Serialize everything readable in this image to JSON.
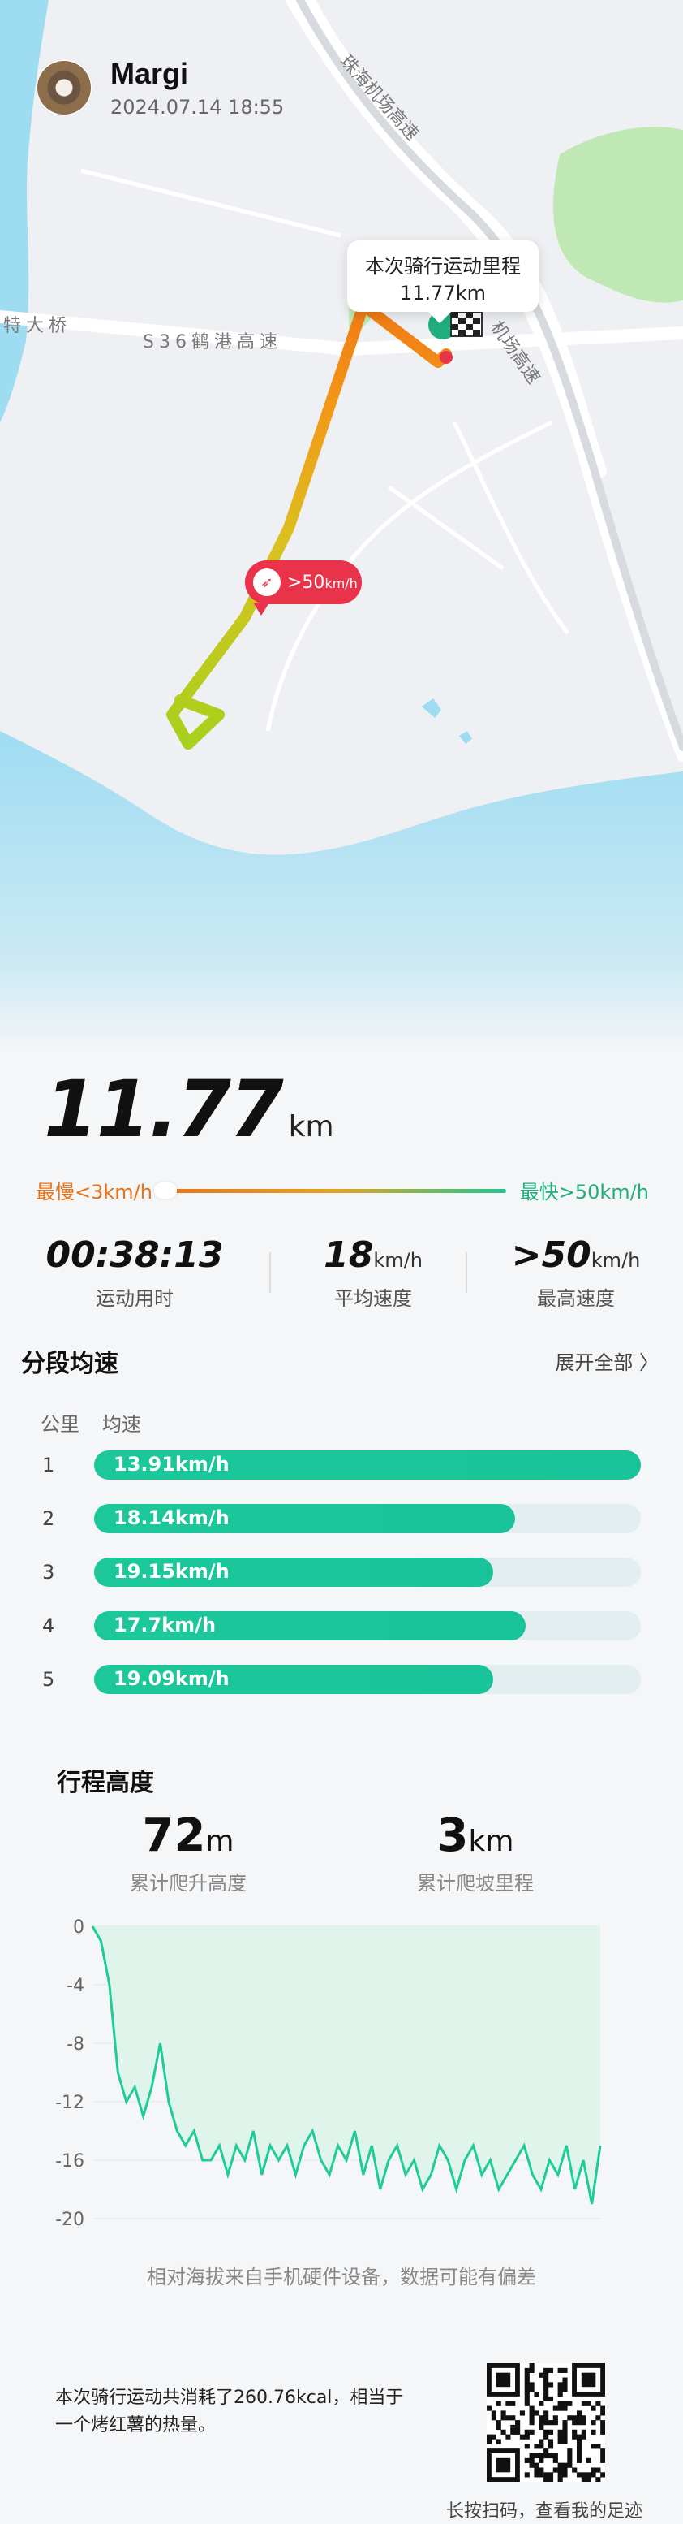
{
  "user": {
    "name": "Margi",
    "datetime": "2024.07.14 18:55"
  },
  "map": {
    "road_labels": [
      "珠海机场高速",
      "S36鹤港高速",
      "特大桥",
      "机场高速"
    ],
    "tooltip_line1": "本次骑行运动里程",
    "tooltip_line2": "11.77km",
    "speed_marker_prefix": ">50",
    "speed_marker_unit": "km/h",
    "colors": {
      "water": "#9edcf2",
      "land": "#eef0f3",
      "park": "#bfe8b4",
      "route_start": "#a7d11c",
      "route_end": "#f07a14"
    }
  },
  "summary": {
    "distance": "11.77",
    "distance_unit": "km",
    "slowest_label": "最慢<3km/h",
    "fastest_label": "最快>50km/h",
    "duration": "00:38:13",
    "duration_label": "运动用时",
    "avg_speed": "18",
    "avg_speed_unit": "km/h",
    "avg_speed_label": "平均速度",
    "max_speed": ">50",
    "max_speed_unit": "km/h",
    "max_speed_label": "最高速度"
  },
  "segments": {
    "title": "分段均速",
    "expand_label": "展开全部 〉",
    "col_km": "公里",
    "col_speed": "均速",
    "rows": [
      {
        "km": "1",
        "speed": "13.91km/h",
        "fill": 1.0
      },
      {
        "km": "2",
        "speed": "18.14km/h",
        "fill": 0.77
      },
      {
        "km": "3",
        "speed": "19.15km/h",
        "fill": 0.73
      },
      {
        "km": "4",
        "speed": "17.7km/h",
        "fill": 0.79
      },
      {
        "km": "5",
        "speed": "19.09km/h",
        "fill": 0.73
      }
    ]
  },
  "altitude": {
    "title": "行程高度",
    "climb": "72",
    "climb_unit": "m",
    "climb_label": "累计爬升高度",
    "climb_dist": "3",
    "climb_dist_unit": "km",
    "climb_dist_label": "累计爬坡里程",
    "note": "相对海拔来自手机硬件设备，数据可能有偏差"
  },
  "chart_data": {
    "type": "area",
    "title": "",
    "xlabel": "",
    "ylabel": "",
    "ylim": [
      -20,
      0
    ],
    "yticks": [
      "0",
      "-4",
      "-8",
      "-12",
      "-16",
      "-20"
    ],
    "x": [
      0,
      1,
      2,
      3,
      4,
      5,
      6,
      7,
      8,
      9,
      10,
      11,
      12,
      13,
      14,
      15,
      16,
      17,
      18,
      19,
      20,
      21,
      22,
      23,
      24,
      25,
      26,
      27,
      28,
      29,
      30,
      31,
      32,
      33,
      34,
      35,
      36,
      37,
      38,
      39,
      40,
      41,
      42,
      43,
      44,
      45,
      46,
      47,
      48,
      49,
      50,
      51,
      52,
      53,
      54,
      55,
      56,
      57,
      58,
      59,
      60
    ],
    "values": [
      0,
      -1,
      -4,
      -10,
      -12,
      -11,
      -13,
      -11,
      -8,
      -12,
      -14,
      -15,
      -14,
      -16,
      -16,
      -15,
      -17,
      -15,
      -16,
      -14,
      -17,
      -15,
      -16,
      -15,
      -17,
      -15,
      -14,
      -16,
      -17,
      -15,
      -16,
      -14,
      -17,
      -15,
      -18,
      -16,
      -15,
      -17,
      -16,
      -18,
      -17,
      -15,
      -16,
      -18,
      -16,
      -15,
      -17,
      -16,
      -18,
      -17,
      -16,
      -15,
      -17,
      -18,
      -16,
      -17,
      -15,
      -18,
      -16,
      -19,
      -15
    ],
    "color": "#1fcb97"
  },
  "footer": {
    "calorie_text": "本次骑行运动共消耗了260.76kcal，相当于一个烤红薯的热量。",
    "qr_caption": "长按扫码，查看我的足迹"
  }
}
